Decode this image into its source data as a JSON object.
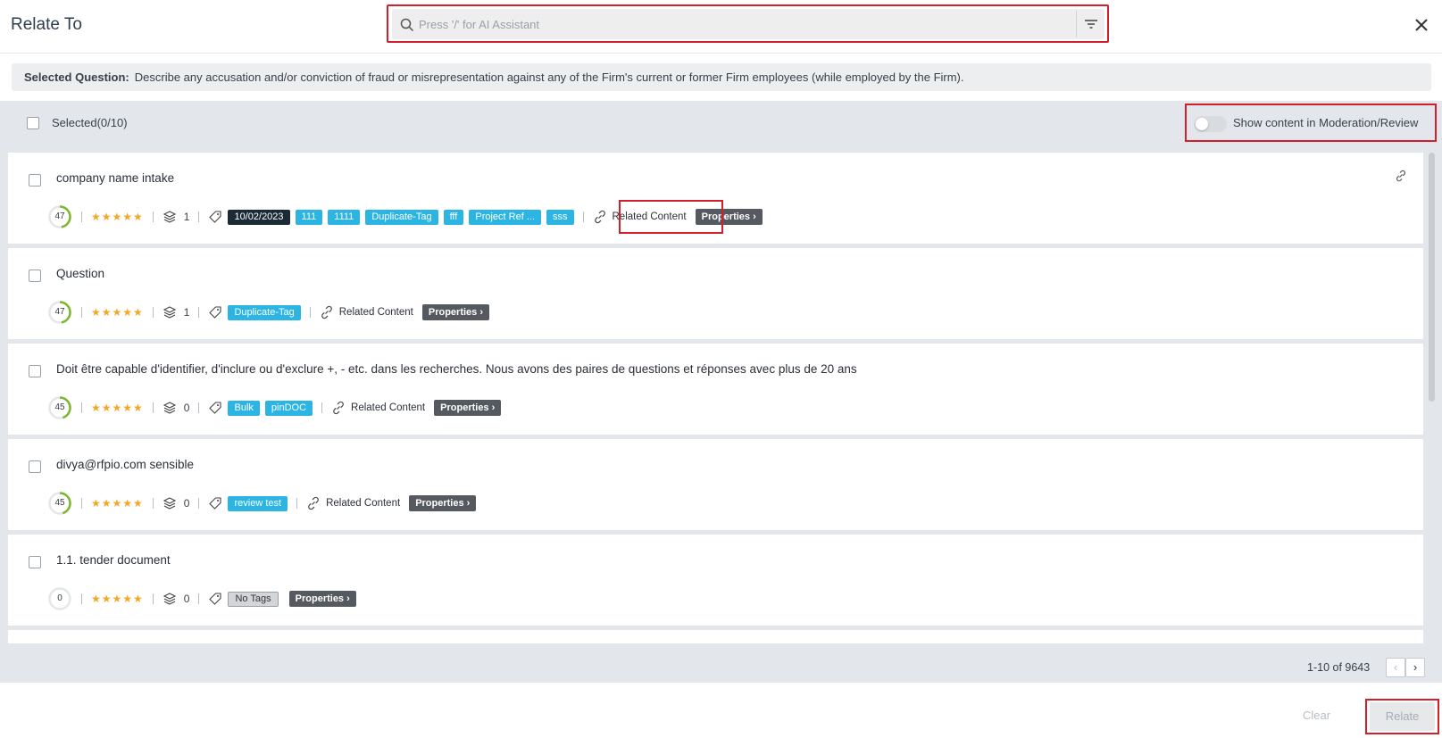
{
  "header": {
    "title": "Relate To",
    "search_placeholder": "Press '/' for AI Assistant"
  },
  "selected_question": {
    "label": "Selected Question:",
    "text": "Describe any accusation and/or conviction of fraud or misrepresentation against any of the Firm's current or former Firm employees (while employed by the Firm)."
  },
  "toolbar": {
    "selected_count": "Selected(0/10)",
    "toggle_label": "Show content in Moderation/Review",
    "toggle_on": false
  },
  "items": [
    {
      "title": "company name intake",
      "score": "47",
      "score_pct": 0.47,
      "stars": "★★★★★",
      "versions": "1",
      "tags": [
        "10/02/2023",
        "111",
        "1111",
        "Duplicate-Tag",
        "fff",
        "Project Ref ...",
        "sss"
      ],
      "related": "Related Content",
      "properties": "Properties"
    },
    {
      "title": "Question",
      "score": "47",
      "score_pct": 0.47,
      "stars": "★★★★★",
      "versions": "1",
      "tags": [
        "Duplicate-Tag"
      ],
      "related": "Related Content",
      "properties": "Properties"
    },
    {
      "title": "Doit être capable d'identifier, d'inclure ou d'exclure +, - etc. dans les recherches. Nous avons des paires de questions et réponses avec plus de 20 ans",
      "score": "45",
      "score_pct": 0.45,
      "stars": "★★★★★",
      "versions": "0",
      "tags": [
        "Bulk",
        "pinDOC"
      ],
      "related": "Related Content",
      "properties": "Properties"
    },
    {
      "title": "divya@rfpio.com sensible",
      "score": "45",
      "score_pct": 0.45,
      "stars": "★★★★★",
      "versions": "0",
      "tags": [
        "review test"
      ],
      "related": "Related Content",
      "properties": "Properties"
    },
    {
      "title": "1.1. tender document",
      "score": "0",
      "score_pct": 0,
      "stars": "★★★★★",
      "versions": "0",
      "no_tags": "No Tags",
      "properties": "Properties"
    }
  ],
  "pagination": {
    "range": "1-10 of 9643",
    "prev": "‹",
    "next": "›"
  },
  "footer": {
    "clear": "Clear",
    "relate": "Relate"
  },
  "colors": {
    "accent_tag": "#2cb5e3",
    "dark_tag": "#1b2b36",
    "score_green": "#7cb82f",
    "star": "#f5a623",
    "highlight": "#d21f2c"
  }
}
